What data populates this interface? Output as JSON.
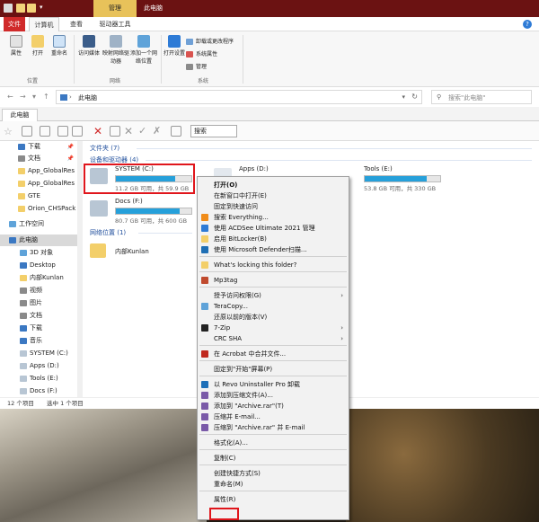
{
  "titlebar": {
    "tool_tab": "管理",
    "title": "此电脑"
  },
  "ribbon_tabs": {
    "file": "文件",
    "computer": "计算机",
    "view": "查看",
    "drive_tools": "驱动器工具"
  },
  "ribbon": {
    "properties": "属性",
    "open": "打开",
    "rename": "重命名",
    "access_media": "访问媒体",
    "map_drive": "映射网络驱动器",
    "add_location": "添加一个网络位置",
    "open_settings": "打开设置",
    "uninstall": "卸载或更改程序",
    "system_props": "系统属性",
    "manage": "管理",
    "group_location": "位置",
    "group_network": "网络",
    "group_system": "系统"
  },
  "address": {
    "path": "此电脑",
    "search_placeholder": "搜索\"此电脑\""
  },
  "tab": {
    "label": "此电脑"
  },
  "toolbar": {
    "search_label": "搜索"
  },
  "nav": {
    "items": [
      {
        "label": "下载",
        "pinned": true
      },
      {
        "label": "文档",
        "pinned": true
      },
      {
        "label": "App_GlobalRes"
      },
      {
        "label": "App_GlobalRes"
      },
      {
        "label": "GTE"
      },
      {
        "label": "Orion_CHSPack"
      },
      {
        "label": "工作空间"
      },
      {
        "label": "此电脑"
      },
      {
        "label": "3D 对象"
      },
      {
        "label": "Desktop"
      },
      {
        "label": "内部Kunlan"
      },
      {
        "label": "视频"
      },
      {
        "label": "图片"
      },
      {
        "label": "文档"
      },
      {
        "label": "下载"
      },
      {
        "label": "音乐"
      },
      {
        "label": "SYSTEM (C:)"
      },
      {
        "label": "Apps (D:)"
      },
      {
        "label": "Tools (E:)"
      },
      {
        "label": "Docs (F:)"
      }
    ]
  },
  "content": {
    "folders_header": "文件夹 (7)",
    "drives_header": "设备和驱动器 (4)",
    "network_header": "网络位置 (1)",
    "drives": [
      {
        "name": "SYSTEM (C:)",
        "info": "11.2 GB 可用，共 59.9 GB",
        "used_fraction": 0.81
      },
      {
        "name": "Apps (D:)",
        "info": "",
        "used_fraction": 0.5
      },
      {
        "name": "Tools (E:)",
        "info": "53.8 GB 可用，共 330 GB",
        "used_fraction": 0.84
      },
      {
        "name": "Docs (F:)",
        "info": "80.7 GB 可用，共 600 GB",
        "used_fraction": 0.87
      }
    ],
    "network_item": "内部Kunlan"
  },
  "status": {
    "count": "12 个项目",
    "selected": "选中 1 个项目"
  },
  "context_menu": {
    "items": [
      {
        "label": "打开(O)",
        "bold": true
      },
      {
        "label": "在新窗口中打开(E)"
      },
      {
        "label": "固定到快速访问"
      },
      {
        "label": "搜索 Everything..."
      },
      {
        "label": "使用 ACDSee Ultimate 2021 管理"
      },
      {
        "label": "启用 BitLocker(B)"
      },
      {
        "label": "使用 Microsoft Defender扫描..."
      },
      {
        "label": "What's locking this folder?"
      },
      {
        "label": "Mp3tag"
      },
      {
        "label": "授予访问权限(G)",
        "submenu": true
      },
      {
        "label": "TeraCopy..."
      },
      {
        "label": "还原以前的版本(V)"
      },
      {
        "label": "7-Zip",
        "submenu": true
      },
      {
        "label": "CRC SHA",
        "submenu": true
      },
      {
        "label": "在 Acrobat 中合并文件..."
      },
      {
        "label": "固定到\"开始\"屏幕(P)"
      },
      {
        "label": "以 Revo Uninstaller Pro 卸载"
      },
      {
        "label": "添加到压缩文件(A)..."
      },
      {
        "label": "添加到 \"Archive.rar\"(T)"
      },
      {
        "label": "压缩并 E-mail..."
      },
      {
        "label": "压缩到 \"Archive.rar\" 并 E-mail"
      },
      {
        "label": "格式化(A)..."
      },
      {
        "label": "复制(C)"
      },
      {
        "label": "创建快捷方式(S)"
      },
      {
        "label": "重命名(M)"
      },
      {
        "label": "属性(R)"
      }
    ]
  }
}
